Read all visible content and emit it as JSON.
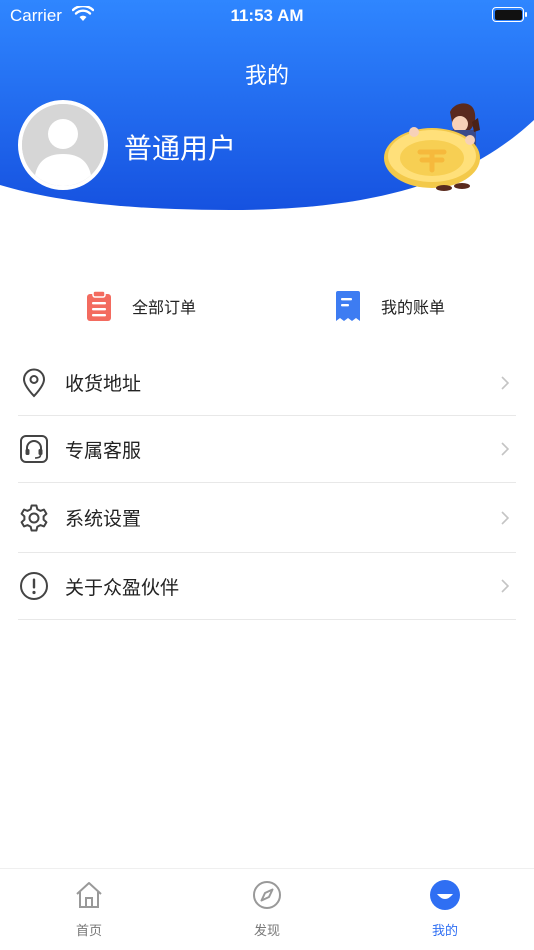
{
  "status_bar": {
    "carrier": "Carrier",
    "time": "11:53 AM"
  },
  "header": {
    "title": "我的",
    "username": "普通用户",
    "gradient_start": "#2f86ff",
    "gradient_end": "#1652e0"
  },
  "quick_actions": [
    {
      "label": "全部订单",
      "icon": "clipboard-icon",
      "color": "#f36b5f"
    },
    {
      "label": "我的账单",
      "icon": "receipt-icon",
      "color": "#3d7cf2"
    }
  ],
  "menu": [
    {
      "label": "收货地址",
      "icon": "location-pin-icon"
    },
    {
      "label": "专属客服",
      "icon": "headset-icon"
    },
    {
      "label": "系统设置",
      "icon": "gear-icon"
    },
    {
      "label": "关于众盈伙伴",
      "icon": "info-icon"
    }
  ],
  "tabbar": {
    "items": [
      {
        "label": "首页",
        "icon": "home-icon",
        "active": false
      },
      {
        "label": "发现",
        "icon": "compass-icon",
        "active": false
      },
      {
        "label": "我的",
        "icon": "profile-icon",
        "active": true
      }
    ],
    "active_color": "#2f6ff3",
    "inactive_color": "#777777"
  }
}
